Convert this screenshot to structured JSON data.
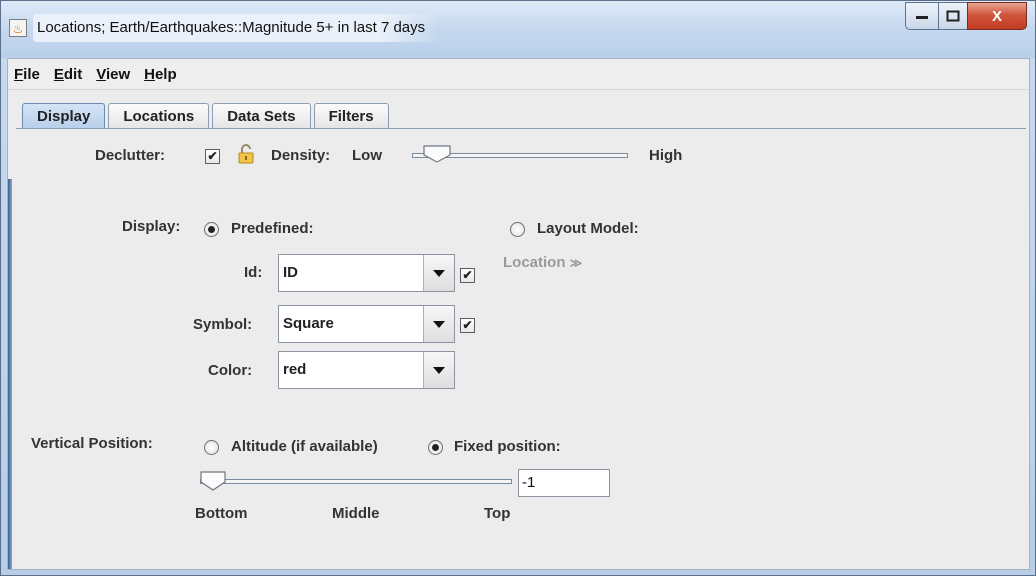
{
  "window": {
    "title": "Locations; Earth/Earthquakes::Magnitude 5+ in last 7 days",
    "minimize": "—",
    "maximize": "▢",
    "close": "X"
  },
  "menu": {
    "items": [
      {
        "first": "F",
        "rest": "ile"
      },
      {
        "first": "E",
        "rest": "dit"
      },
      {
        "first": "V",
        "rest": "iew"
      },
      {
        "first": "H",
        "rest": "elp"
      }
    ]
  },
  "tabs": {
    "display": "Display",
    "locations": "Locations",
    "data_sets": "Data Sets",
    "filters": "Filters",
    "active": "Display"
  },
  "declutter": {
    "label": "Declutter:",
    "checked": true,
    "check_glyph": "✔",
    "density_label": "Density:",
    "low": "Low",
    "high": "High",
    "density_value": 0.06
  },
  "display": {
    "label": "Display:",
    "predefined": "Predefined:",
    "layout_model": "Layout Model:",
    "layout_value": "Location",
    "layout_chevron": "≫",
    "selected": "Predefined",
    "id_label": "Id:",
    "id_value": "ID",
    "id_checked": true,
    "symbol_label": "Symbol:",
    "symbol_value": "Square",
    "symbol_checked": true,
    "color_label": "Color:",
    "color_value": "red"
  },
  "vertical": {
    "label": "Vertical Position:",
    "altitude": "Altitude (if available)",
    "fixed": "Fixed position:",
    "selected": "Fixed position",
    "value": "-1",
    "bottom": "Bottom",
    "middle": "Middle",
    "top": "Top",
    "slider_value": 0.0
  },
  "colors": {
    "accent": "#b7cfea",
    "close_button": "#c13b22"
  }
}
